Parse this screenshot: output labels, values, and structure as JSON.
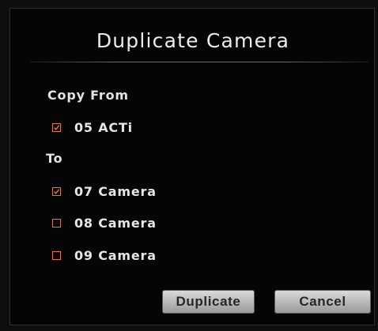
{
  "dialog": {
    "title": "Duplicate Camera",
    "copy_from_label": "Copy From",
    "source": {
      "label": "05 ACTi",
      "checked": true
    },
    "to_label": "To",
    "targets": [
      {
        "label": "07 Camera",
        "checked": true
      },
      {
        "label": "08 Camera",
        "checked": false
      },
      {
        "label": "09 Camera",
        "checked": false
      }
    ],
    "buttons": {
      "duplicate": "Duplicate",
      "cancel": "Cancel"
    }
  },
  "colors": {
    "accent": "#e0793a",
    "background": "#050505",
    "text": "#e6e6e6"
  }
}
